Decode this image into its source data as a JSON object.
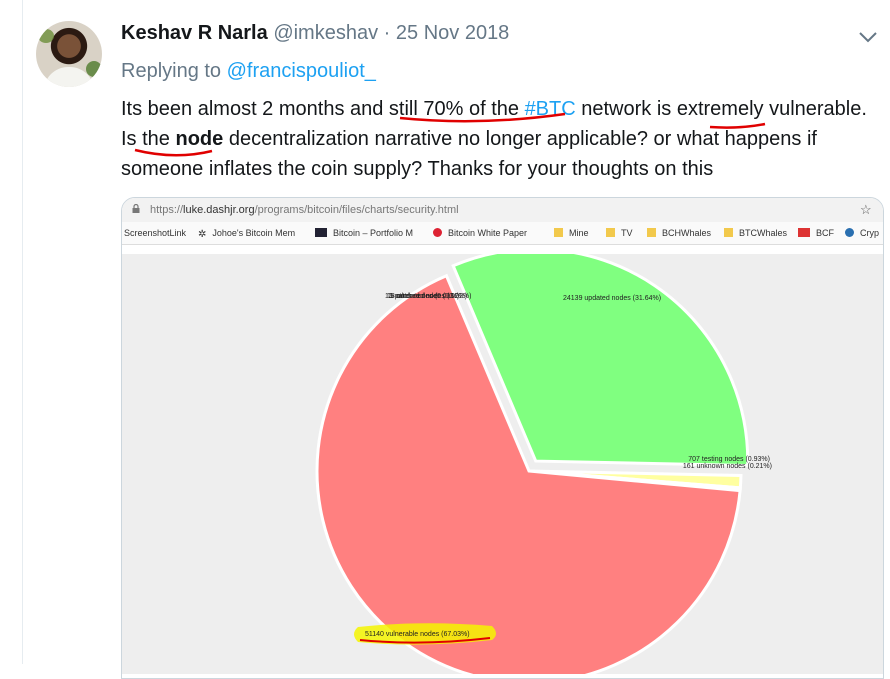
{
  "tweet": {
    "name": "Keshav R Narla",
    "handle": "@imkeshav",
    "dot": "·",
    "date": "25 Nov 2018",
    "replying_prefix": "Replying to",
    "replying_to": "@francispouliot_",
    "text_1": "Its been almost 2 months and still 70% of the ",
    "hashtag": "#BTC",
    "text_2": " network is extremely vulnerable. Is the ",
    "bold_word": "node",
    "text_3": " decentralization narrative no longer applicable? or what happens if someone inflates the coin supply? Thanks for your thoughts on this"
  },
  "browser": {
    "url_prefix": "https://",
    "url_host": "luke.dashjr.org",
    "url_path": "/programs/bitcoin/files/charts/security.html",
    "star": "☆",
    "bookmarks": [
      {
        "label": "ScreenshotLink",
        "icon": "none"
      },
      {
        "label": "Johoe's Bitcoin Mem",
        "icon": "glyph-icon"
      },
      {
        "label": "Bitcoin – Portfolio M",
        "icon": "sc-icon"
      },
      {
        "label": "Bitcoin White Paper",
        "icon": "chili-icon"
      },
      {
        "label": "Mine",
        "icon": "folder-icon"
      },
      {
        "label": "TV",
        "icon": "folder-icon"
      },
      {
        "label": "BCHWhales",
        "icon": "folder-icon"
      },
      {
        "label": "BTCWhales",
        "icon": "folder-icon"
      },
      {
        "label": "BCF",
        "icon": "red-badge-icon"
      },
      {
        "label": "Cryp",
        "icon": "coin-icon"
      }
    ]
  },
  "chart_data": {
    "type": "pie",
    "slices": [
      {
        "label": "24139 updated nodes (31.64%)",
        "count": 24139,
        "percent": 31.64,
        "color": "#80ff80"
      },
      {
        "label": "707 testing nodes (0.93%)",
        "count": 707,
        "percent": 0.93,
        "color": "#ffffa0"
      },
      {
        "label": "161 unknown nodes (0.21%)",
        "count": 161,
        "percent": 0.21,
        "color": "#ffc080"
      },
      {
        "label": "51140 vulnerable nodes (67.03%)",
        "count": 51140,
        "percent": 67.03,
        "color": "#ff8080"
      }
    ],
    "small_labels": [
      "13 patched nodes (0.02%)",
      "18 outdated nodes (0.02%)",
      "5 other nodes (0.01%)"
    ],
    "highlight_color": "#f4f400",
    "underline_color": "#e00000"
  }
}
